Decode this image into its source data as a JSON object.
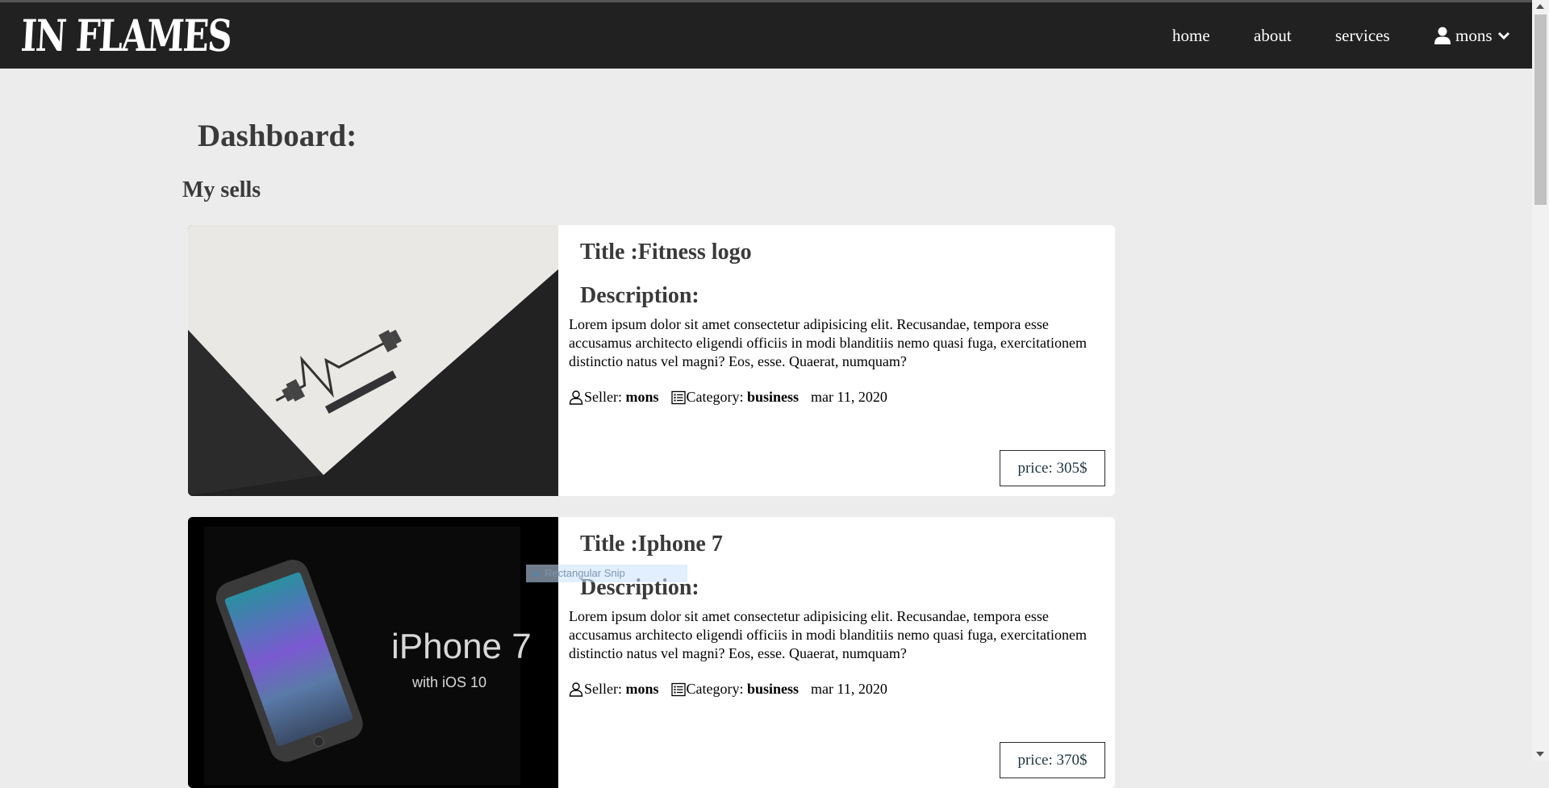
{
  "header": {
    "logo_text": "IN FLAMES",
    "nav": [
      "home",
      "about",
      "services"
    ],
    "user_name": "mons"
  },
  "page": {
    "title": "Dashboard:",
    "section": "My sells"
  },
  "cards": [
    {
      "image_alt": "fitness logo mockup on paper",
      "title": "Title :Fitness logo",
      "description_label": "Description:",
      "description": "Lorem ipsum dolor sit amet consectetur adipisicing elit. Recusandae, tempora esse accusamus architecto eligendi officiis in modi blanditiis nemo quasi fuga, exercitationem distinctio natus vel magni? Eos, esse. Quaerat, numquam?",
      "seller_label": "Seller:",
      "seller": "mons",
      "category_label": "Category:",
      "category": "business",
      "date": "mar 11, 2020",
      "price": "price: 305$"
    },
    {
      "image_alt": "iPhone 7 promo image",
      "image_text": "iPhone 7",
      "image_subtext": "with iOS 10",
      "title": "Title :Iphone 7",
      "description_label": "Description:",
      "description": "Lorem ipsum dolor sit amet consectetur adipisicing elit. Recusandae, tempora esse accusamus architecto eligendi officiis in modi blanditiis nemo quasi fuga, exercitationem distinctio natus vel magni? Eos, esse. Quaerat, numquam?",
      "seller_label": "Seller:",
      "seller": "mons",
      "category_label": "Category:",
      "category": "business",
      "date": "mar 11, 2020",
      "price": "price: 370$"
    }
  ],
  "overlay": {
    "snip_label": "Rectangular Snip"
  },
  "colors": {
    "header_bg": "#212121",
    "page_bg": "#ececec",
    "card_bg": "#ffffff",
    "heading": "#3a3a3a"
  }
}
